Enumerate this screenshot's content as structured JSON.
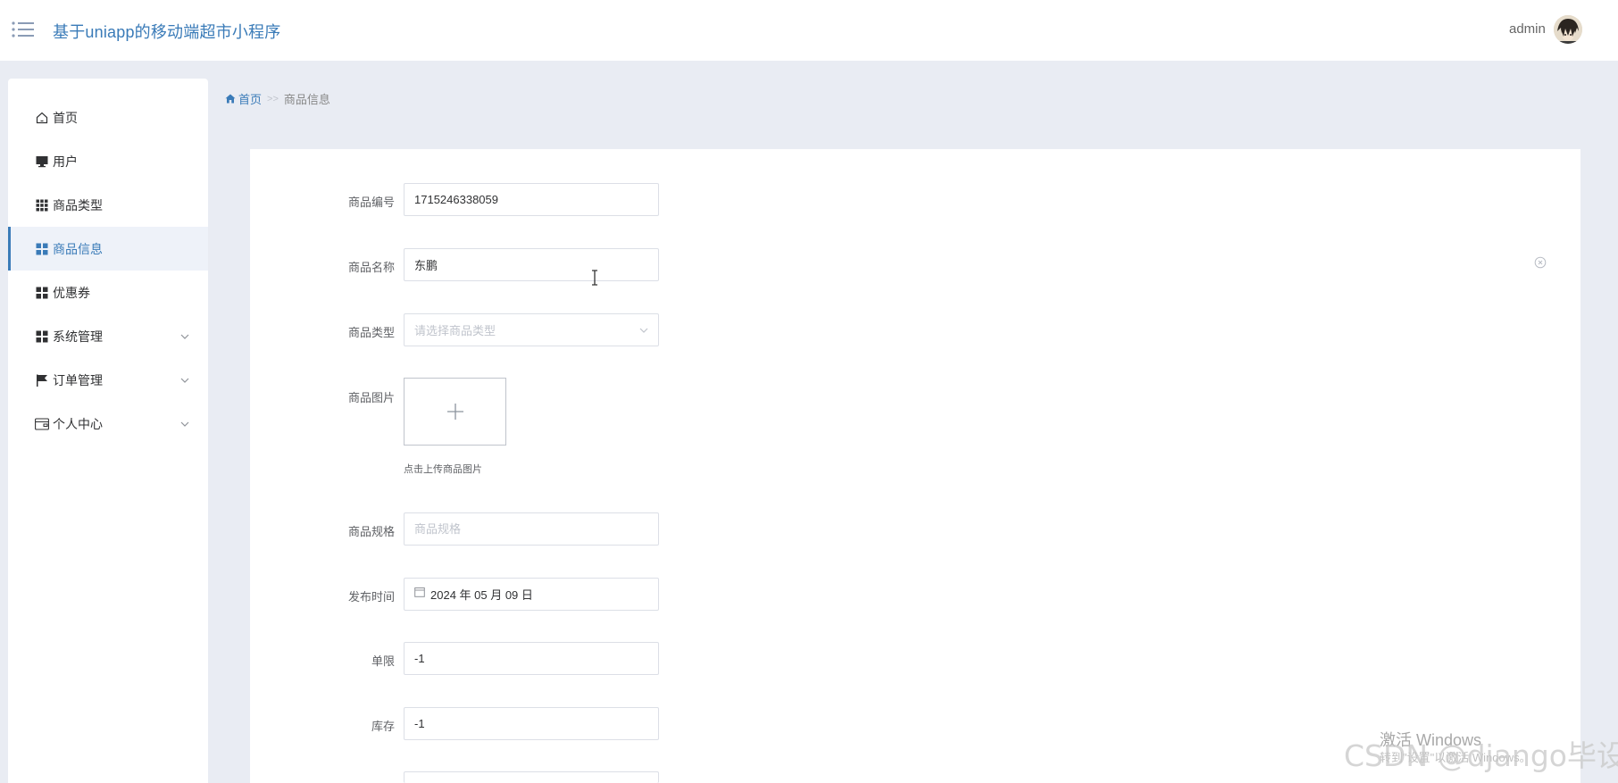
{
  "header": {
    "title": "基于uniapp的移动端超市小程序",
    "user_name": "admin"
  },
  "sidebar": {
    "items": [
      {
        "label": "首页",
        "icon": "home-icon"
      },
      {
        "label": "用户",
        "icon": "monitor-icon"
      },
      {
        "label": "商品类型",
        "icon": "grid-icon"
      },
      {
        "label": "商品信息",
        "icon": "grid-icon",
        "active": true
      },
      {
        "label": "优惠券",
        "icon": "grid-icon"
      },
      {
        "label": "系统管理",
        "icon": "grid-icon",
        "expandable": true
      },
      {
        "label": "订单管理",
        "icon": "flag-icon",
        "expandable": true
      },
      {
        "label": "个人中心",
        "icon": "wallet-icon",
        "expandable": true
      }
    ]
  },
  "breadcrumb": {
    "home": "首页",
    "separator": ">>",
    "current": "商品信息"
  },
  "form": {
    "code_label": "商品编号",
    "code_value": "1715246338059",
    "name_label": "商品名称",
    "name_value": "东鹏",
    "type_label": "商品类型",
    "type_placeholder": "请选择商品类型",
    "image_label": "商品图片",
    "image_hint": "点击上传商品图片",
    "spec_label": "商品规格",
    "spec_placeholder": "商品规格",
    "date_label": "发布时间",
    "date_value": "2024 年 05 月 09 日",
    "limit_label": "单限",
    "limit_value": "-1",
    "stock_label": "库存",
    "stock_value": "-1"
  },
  "watermarks": {
    "windows": "激活 Windows",
    "windows_sub": "转到\"设置\"以激活 Windows。",
    "csdn": "CSDN @django毕设"
  },
  "colors": {
    "accent": "#3a7bb8",
    "background": "#e9ecf3"
  }
}
